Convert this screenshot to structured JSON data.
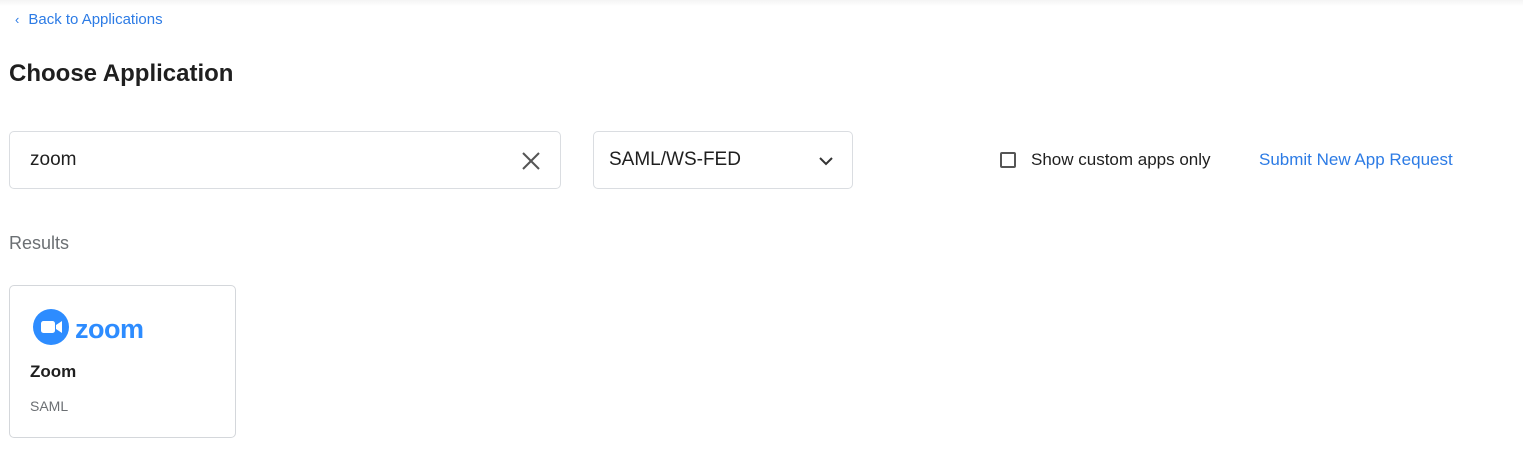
{
  "nav": {
    "back_label": "Back to Applications"
  },
  "page": {
    "title": "Choose Application"
  },
  "search": {
    "value": "zoom",
    "placeholder": ""
  },
  "filter": {
    "selected": "SAML/WS-FED"
  },
  "custom_apps": {
    "label": "Show custom apps only",
    "checked": false
  },
  "submit_link": "Submit New App Request",
  "results": {
    "label": "Results",
    "items": [
      {
        "logo_text": "zoom",
        "name": "Zoom",
        "type": "SAML"
      }
    ]
  },
  "colors": {
    "link": "#2c7be5",
    "zoom_brand": "#2d8cff",
    "border": "#dadde1"
  },
  "icons": {
    "back": "chevron-left-icon",
    "clear": "close-icon",
    "dropdown": "chevron-down-icon",
    "checkbox": "checkbox-unchecked-icon",
    "app_logo": "zoom-camera-icon"
  }
}
